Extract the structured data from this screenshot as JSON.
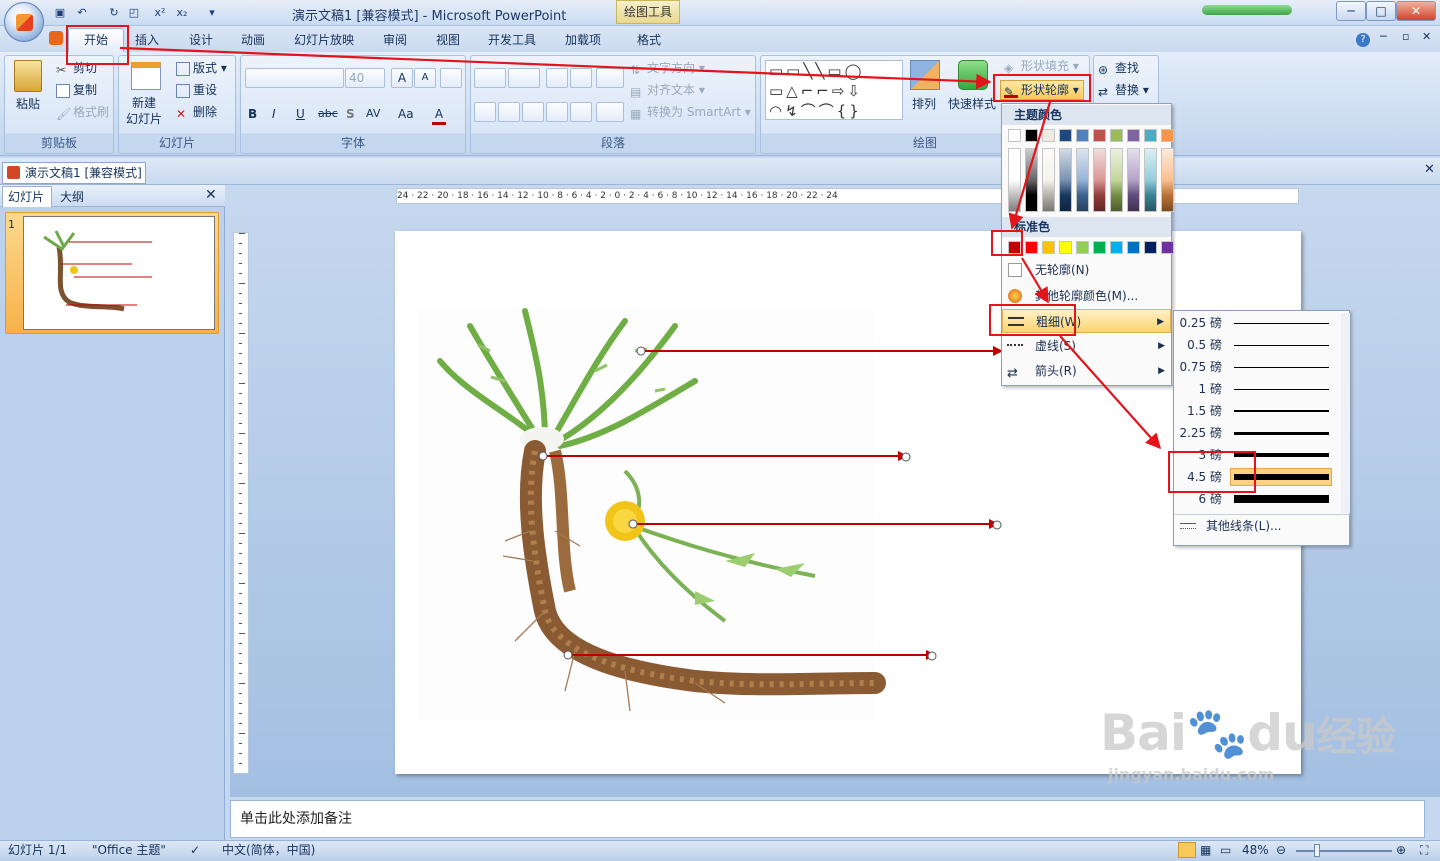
{
  "window": {
    "title": "演示文稿1 [兼容模式] - Microsoft PowerPoint",
    "context_tab": "绘图工具",
    "controls": [
      "─",
      "□",
      "✕"
    ]
  },
  "quick_access": {
    "save": "save-icon",
    "undo": "undo-icon",
    "redo": "redo-icon",
    "superscript": "x²",
    "subscript": "x₂"
  },
  "tabs": [
    "开始",
    "插入",
    "设计",
    "动画",
    "幻灯片放映",
    "审阅",
    "视图",
    "开发工具",
    "加载项",
    "格式"
  ],
  "ribbon": {
    "clipboard": {
      "label": "剪贴板",
      "paste": "粘贴",
      "cut": "剪切",
      "copy": "复制",
      "format_painter": "格式刷"
    },
    "slides": {
      "label": "幻灯片",
      "new_slide": "新建\n幻灯片",
      "layout": "版式",
      "reset": "重设",
      "delete": "删除"
    },
    "font": {
      "label": "字体",
      "size": "40",
      "bold": "B",
      "italic": "I",
      "underline": "U",
      "strike": "abc",
      "shadow": "S",
      "spacing": "AV",
      "case": "Aa",
      "color": "A"
    },
    "paragraph": {
      "label": "段落",
      "text_direction": "文字方向",
      "align_text": "对齐文本",
      "smartart": "转换为 SmartArt"
    },
    "drawing": {
      "label": "绘图",
      "arrange": "排列",
      "quick_styles": "快速样式",
      "shape_fill": "形状填充",
      "shape_outline": "形状轮廓"
    },
    "editing": {
      "find": "查找",
      "replace": "替换"
    }
  },
  "doc_tab": "演示文稿1 [兼容模式]",
  "left_pane": {
    "tabs": [
      "幻灯片",
      "大纲"
    ],
    "slide_number": "1"
  },
  "ruler": {
    "h": "24 · 22 · 20 · 18 · 16 · 14 · 12 · 10 · 8 · 6 · 4 · 2 · 0 · 2 · 4 · 6 · 8 · 10 · 12 · 14 · 16 · 18 · 20 · 22 · 24"
  },
  "notes_placeholder": "单击此处添加备注",
  "status": {
    "slide": "幻灯片 1/1",
    "theme": "\"Office 主题\"",
    "lang": "中文(简体，中国)",
    "zoom": "48%"
  },
  "outline_menu": {
    "theme_colors_heading": "主题颜色",
    "standard_colors_heading": "标准色",
    "no_outline": "无轮廓(N)",
    "more_colors": "其他轮廓颜色(M)...",
    "weight": "粗细(W)",
    "dashes": "虚线(S)",
    "arrows": "箭头(R)",
    "theme_colors": [
      "#ffffff",
      "#000000",
      "#eeece1",
      "#1f497d",
      "#4f81bd",
      "#c0504d",
      "#9bbb59",
      "#8064a2",
      "#4bacc6",
      "#f79646"
    ],
    "standard_colors": [
      "#c00000",
      "#ff0000",
      "#ffc000",
      "#ffff00",
      "#92d050",
      "#00b050",
      "#00b0f0",
      "#0070c0",
      "#002060",
      "#7030a0"
    ]
  },
  "weight_menu": {
    "items": [
      {
        "label": "0.25 磅",
        "pt": 0.25
      },
      {
        "label": "0.5 磅",
        "pt": 0.5
      },
      {
        "label": "0.75 磅",
        "pt": 0.75
      },
      {
        "label": "1 磅",
        "pt": 1
      },
      {
        "label": "1.5 磅",
        "pt": 1.5
      },
      {
        "label": "2.25 磅",
        "pt": 2.25
      },
      {
        "label": "3 磅",
        "pt": 3
      },
      {
        "label": "4.5 磅",
        "pt": 4.5
      },
      {
        "label": "6 磅",
        "pt": 6
      }
    ],
    "selected": "4.5 磅",
    "more_lines": "其他线条(L)..."
  },
  "watermark": {
    "brand": "Bai",
    "brand2": "du",
    "cn": "经验",
    "url": "jingyan.baidu.com"
  },
  "colors": {
    "annotation_red": "#e3141b",
    "arrow_red": "#c00000",
    "highlight": "#ffd280"
  }
}
